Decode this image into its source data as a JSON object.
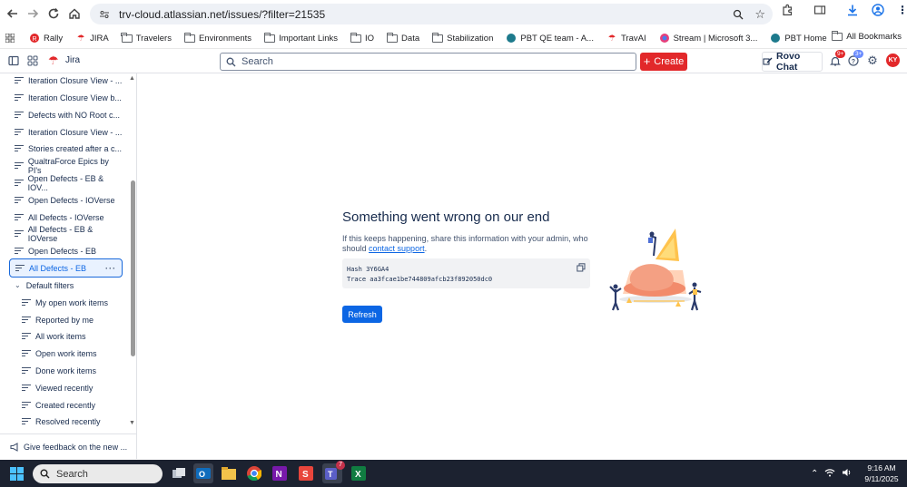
{
  "browser": {
    "url": "trv-cloud.atlassian.net/issues/?filter=21535",
    "bookmarks": [
      "Rally",
      "JIRA",
      "Travelers",
      "Environments",
      "Important Links",
      "IO",
      "Data",
      "Stabilization",
      "PBT QE team - A...",
      "TravAI",
      "Stream | Microsoft 3...",
      "PBT Home"
    ],
    "all_bookmarks": "All Bookmarks"
  },
  "jira": {
    "app_name": "Jira",
    "search_placeholder": "Search",
    "create_label": "Create",
    "rovo_label": "Rovo Chat",
    "notifications_badge": "9+",
    "help_badge": "3+",
    "avatar_initials": "KY"
  },
  "sidebar": {
    "items": [
      "Iteration Closure View - ...",
      "Iteration Closure View b...",
      "Defects with NO Root c...",
      "Iteration Closure View - ...",
      "Stories created after a c...",
      "QualtraForce Epics by PI's",
      "Open Defects - EB & IOV...",
      "Open Defects - IOVerse",
      "All Defects - IOVerse",
      "All Defects - EB & IOVerse",
      "Open Defects - EB",
      "All Defects - EB"
    ],
    "default_filters_label": "Default filters",
    "default_filters": [
      "My open work items",
      "Reported by me",
      "All work items",
      "Open work items",
      "Done work items",
      "Viewed recently",
      "Created recently",
      "Resolved recently"
    ],
    "feedback": "Give feedback on the new ..."
  },
  "error": {
    "title": "Something went wrong on our end",
    "message_prefix": "If this keeps happening, share this information with your admin, who should ",
    "message_link": "contact support",
    "message_suffix": ".",
    "hash": "Hash 3Y6GA4",
    "trace": "Trace aa3fcae1be744809afcb23f892050dc0",
    "refresh_label": "Refresh"
  },
  "taskbar": {
    "search_placeholder": "Search",
    "teams_badge": "7",
    "time": "9:16 AM",
    "date": "9/11/2025"
  },
  "colors": {
    "accent": "#0c66e4",
    "create": "#e2282a",
    "taskbar": "#1c2230"
  }
}
